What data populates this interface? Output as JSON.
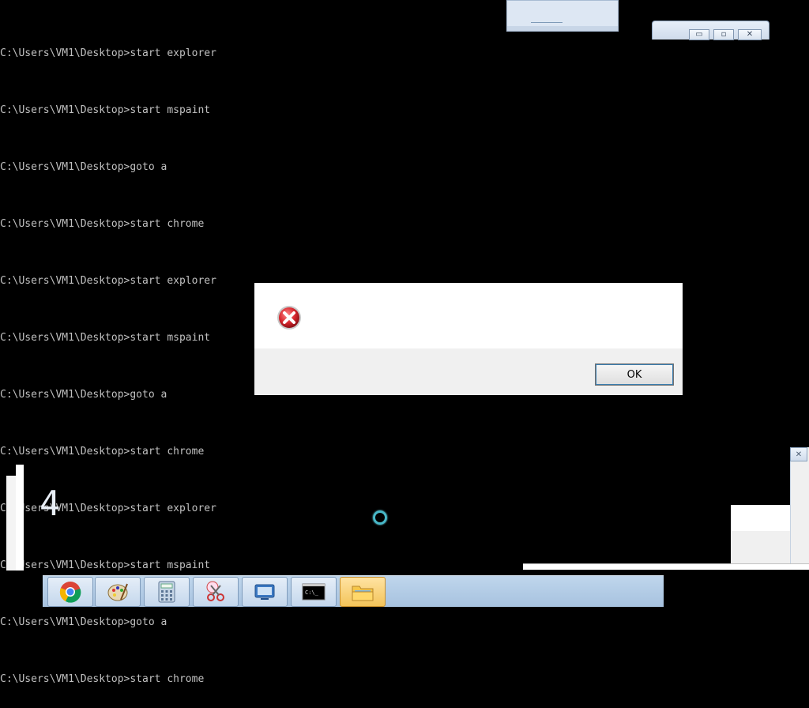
{
  "console": {
    "lines": [
      "C:\\Users\\VM1\\Desktop>start explorer",
      "C:\\Users\\VM1\\Desktop>start mspaint",
      "C:\\Users\\VM1\\Desktop>goto a",
      "C:\\Users\\VM1\\Desktop>start chrome",
      "C:\\Users\\VM1\\Desktop>start explorer",
      "C:\\Users\\VM1\\Desktop>start mspaint",
      "C:\\Users\\VM1\\Desktop>goto a",
      "C:\\Users\\VM1\\Desktop>start chrome",
      "C:\\Users\\VM1\\Desktop>start explorer",
      "C:\\Users\\VM1\\Desktop>start mspaint",
      "C:\\Users\\VM1\\Desktop>goto a",
      "C:\\Users\\VM1\\Desktop>start chrome"
    ]
  },
  "caption_buttons": {
    "minimize": "▭",
    "maximize": "▫",
    "close": "✕"
  },
  "dialog": {
    "icon": "error-icon",
    "ok_label": "OK"
  },
  "remnant": {
    "glyph": "4"
  },
  "taskbar": {
    "items": [
      {
        "name": "chrome",
        "icon": "chrome-icon",
        "active": false
      },
      {
        "name": "paint",
        "icon": "palette-icon",
        "active": false
      },
      {
        "name": "calculator",
        "icon": "calculator-icon",
        "active": false
      },
      {
        "name": "snipping-tool",
        "icon": "scissors-icon",
        "active": false
      },
      {
        "name": "remote-desktop",
        "icon": "window-icon",
        "active": false
      },
      {
        "name": "command-prompt",
        "icon": "terminal-icon",
        "active": false
      },
      {
        "name": "explorer",
        "icon": "folder-icon",
        "active": true
      }
    ],
    "terminal_glyph": "C:\\_"
  },
  "colors": {
    "desktop": "#000000",
    "console_text": "#c0c0c0",
    "error_red": "#d8282f",
    "taskbar": "#b4cce6"
  }
}
